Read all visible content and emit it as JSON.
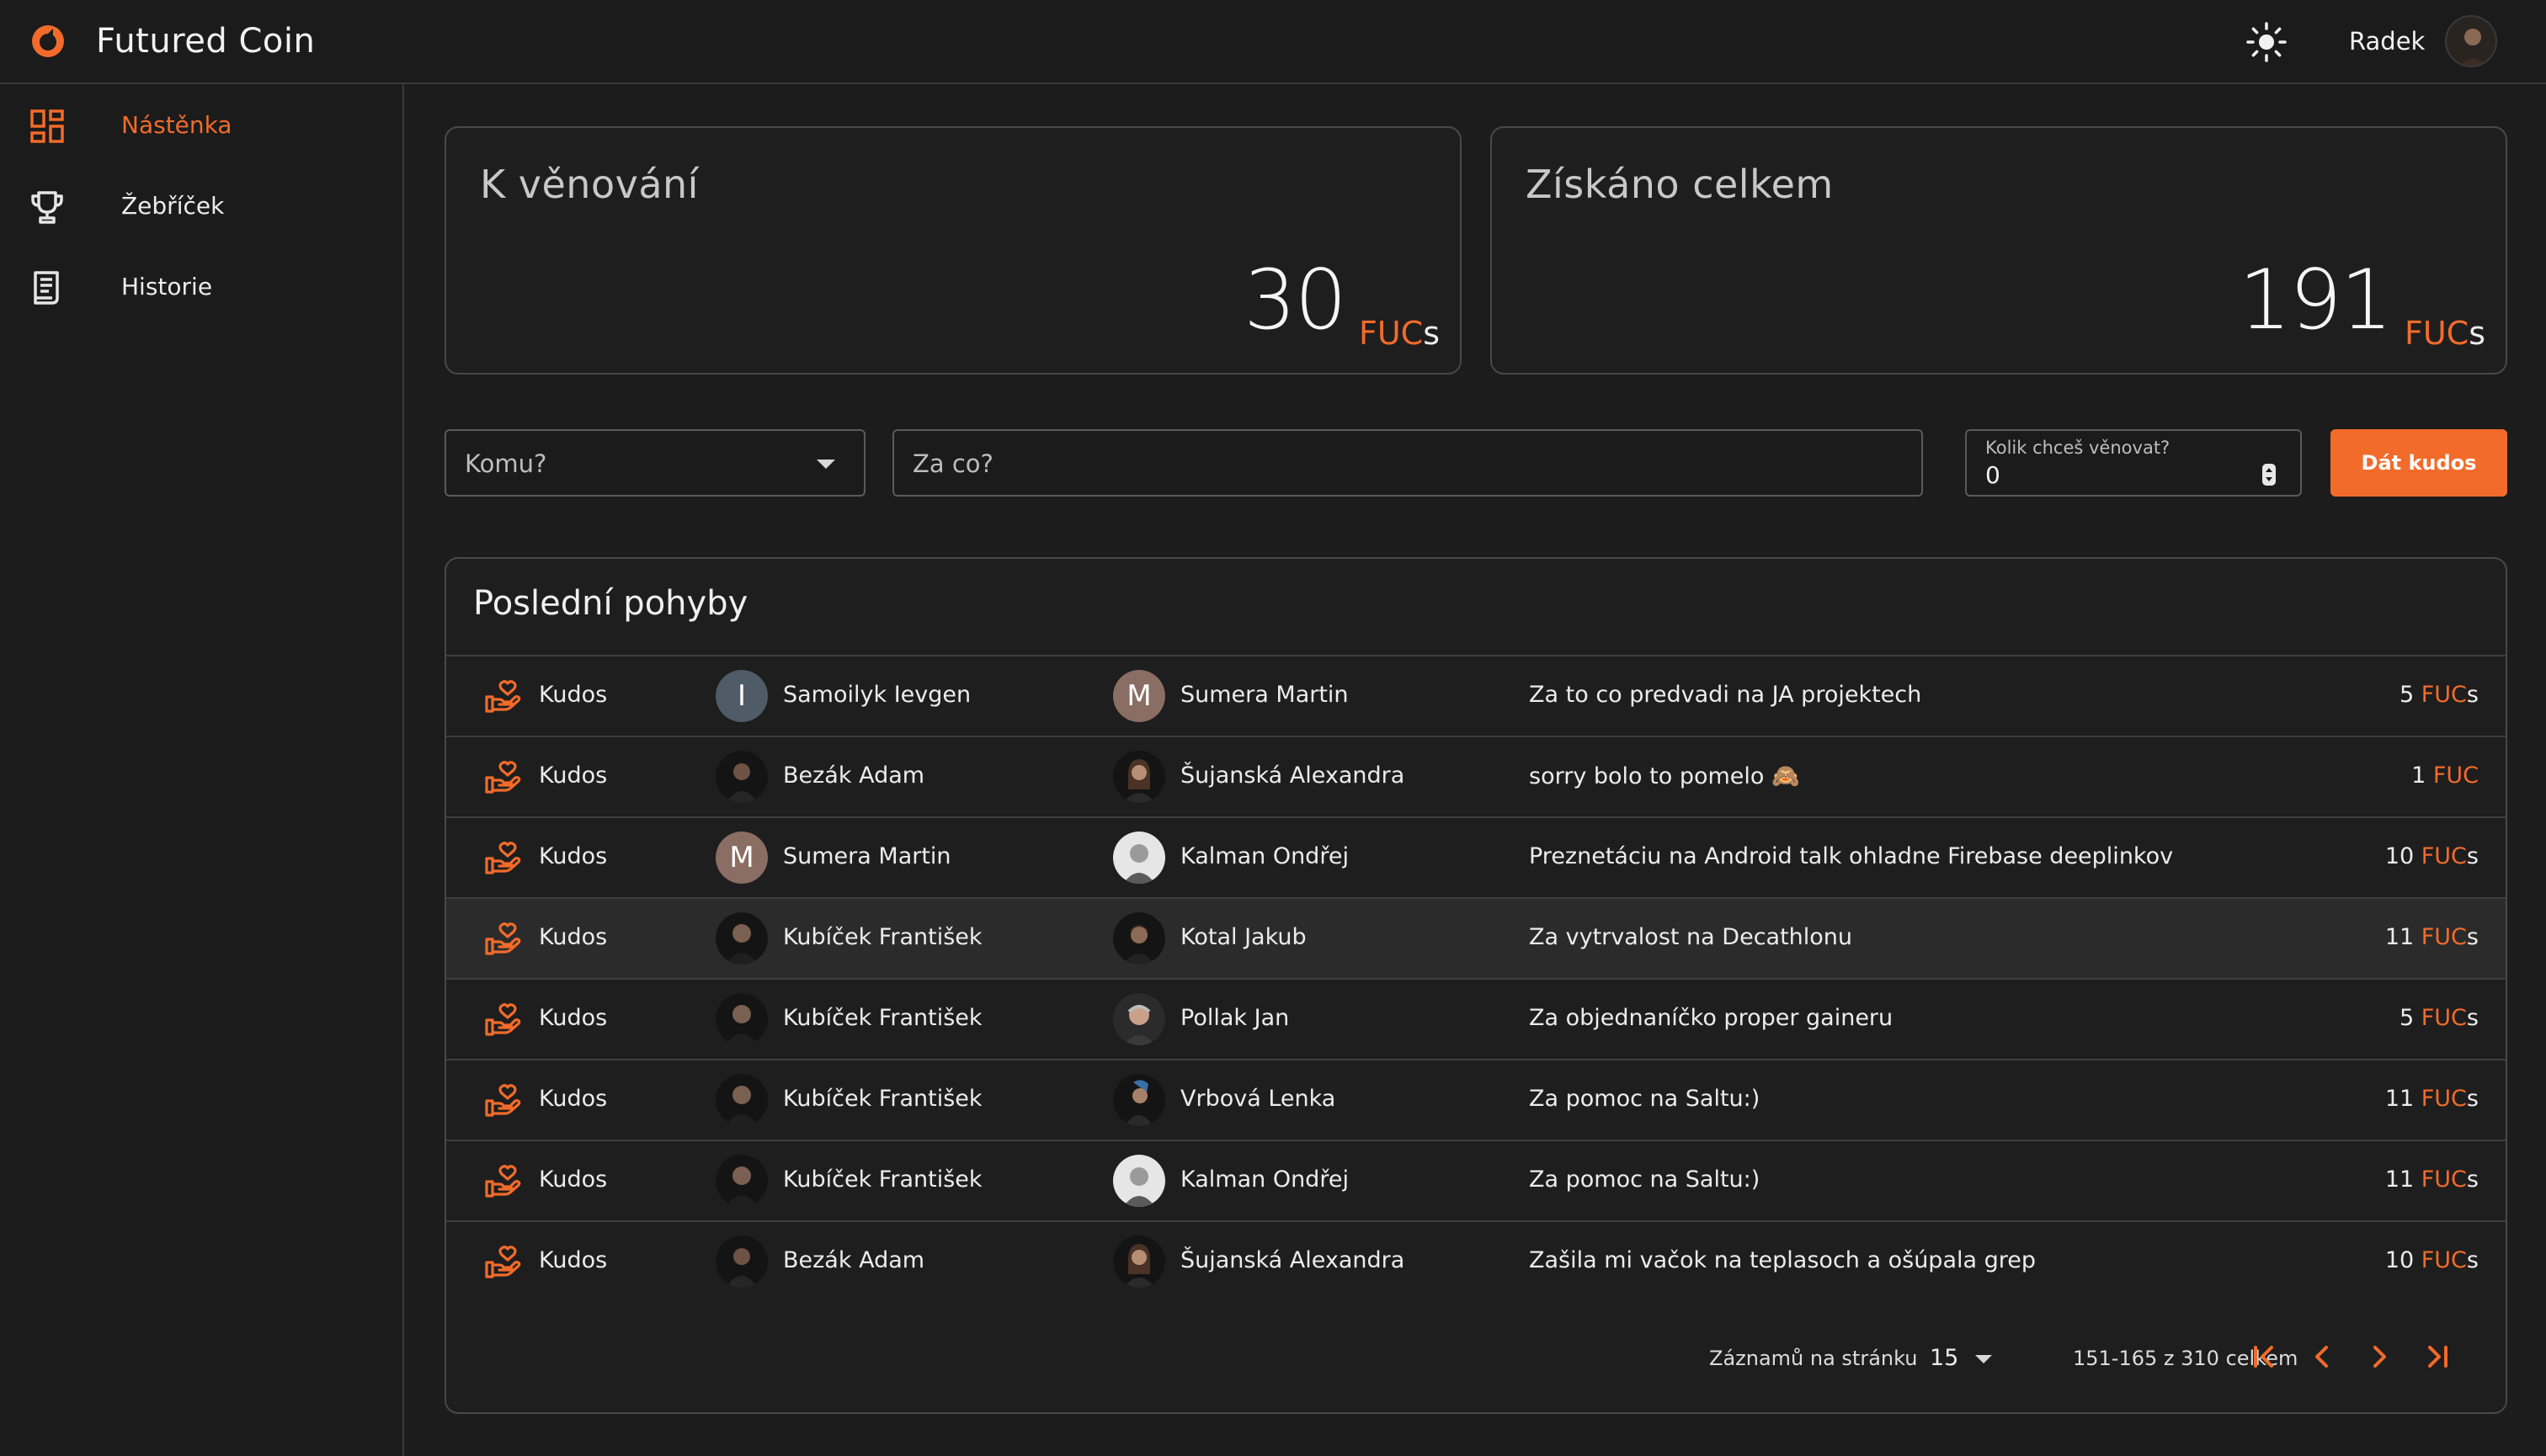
{
  "header": {
    "app_title": "Futured Coin",
    "username": "Radek",
    "theme_icon": "sun-icon"
  },
  "colors": {
    "accent": "#f26b2a",
    "background": "#1c1c1c",
    "panel_border": "#484848"
  },
  "sidebar": {
    "items": [
      {
        "label": "Nástěnka",
        "icon": "dashboard-icon",
        "active": true
      },
      {
        "label": "Žebříček",
        "icon": "trophy-icon",
        "active": false
      },
      {
        "label": "Historie",
        "icon": "receipt-icon",
        "active": false
      }
    ]
  },
  "stats": {
    "to_give": {
      "title": "K věnování",
      "value": "30",
      "unit_prefix": "FUC",
      "unit_suffix": "s"
    },
    "received": {
      "title": "Získáno celkem",
      "value": "191",
      "unit_prefix": "FUC",
      "unit_suffix": "s"
    }
  },
  "form": {
    "recipient_placeholder": "Komu?",
    "reason_placeholder": "Za co?",
    "amount_label": "Kolik chceš věnovat?",
    "amount_value": "0",
    "submit_label": "Dát kudos"
  },
  "panel": {
    "title": "Poslední pohyby",
    "rows": [
      {
        "type": "Kudos",
        "from": "Samoilyk Ievgen",
        "to": "Sumera Martin",
        "reason": "Za to co predvadi na JA projektech",
        "amount": "5",
        "unit": "FUC",
        "suffix": "s"
      },
      {
        "type": "Kudos",
        "from": "Bezák Adam",
        "to": "Šujanská Alexandra",
        "reason": "sorry bolo to pomelo 🙈",
        "amount": "1",
        "unit": "FUC",
        "suffix": ""
      },
      {
        "type": "Kudos",
        "from": "Sumera Martin",
        "to": "Kalman Ondřej",
        "reason": "Preznetáciu na Android talk ohladne Firebase deeplinkov",
        "amount": "10",
        "unit": "FUC",
        "suffix": "s"
      },
      {
        "type": "Kudos",
        "from": "Kubíček František",
        "to": "Kotal Jakub",
        "reason": "Za vytrvalost na Decathlonu",
        "amount": "11",
        "unit": "FUC",
        "suffix": "s"
      },
      {
        "type": "Kudos",
        "from": "Kubíček František",
        "to": "Pollak Jan",
        "reason": "Za objednaníčko proper gaineru",
        "amount": "5",
        "unit": "FUC",
        "suffix": "s"
      },
      {
        "type": "Kudos",
        "from": "Kubíček František",
        "to": "Vrbová Lenka",
        "reason": "Za pomoc na Saltu:)",
        "amount": "11",
        "unit": "FUC",
        "suffix": "s"
      },
      {
        "type": "Kudos",
        "from": "Kubíček František",
        "to": "Kalman Ondřej",
        "reason": "Za pomoc na Saltu:)",
        "amount": "11",
        "unit": "FUC",
        "suffix": "s"
      },
      {
        "type": "Kudos",
        "from": "Bezák Adam",
        "to": "Šujanská Alexandra",
        "reason": "Zašila mi vačok na teplasoch a ošúpala grep",
        "amount": "10",
        "unit": "FUC",
        "suffix": "s"
      }
    ],
    "avatar_letters": {
      "samoilyk": "I",
      "sumera": "M"
    },
    "pagination": {
      "per_page_label": "Záznamů na stránku",
      "per_page_value": "15",
      "range_text": "151-165 z 310 celkem"
    }
  }
}
